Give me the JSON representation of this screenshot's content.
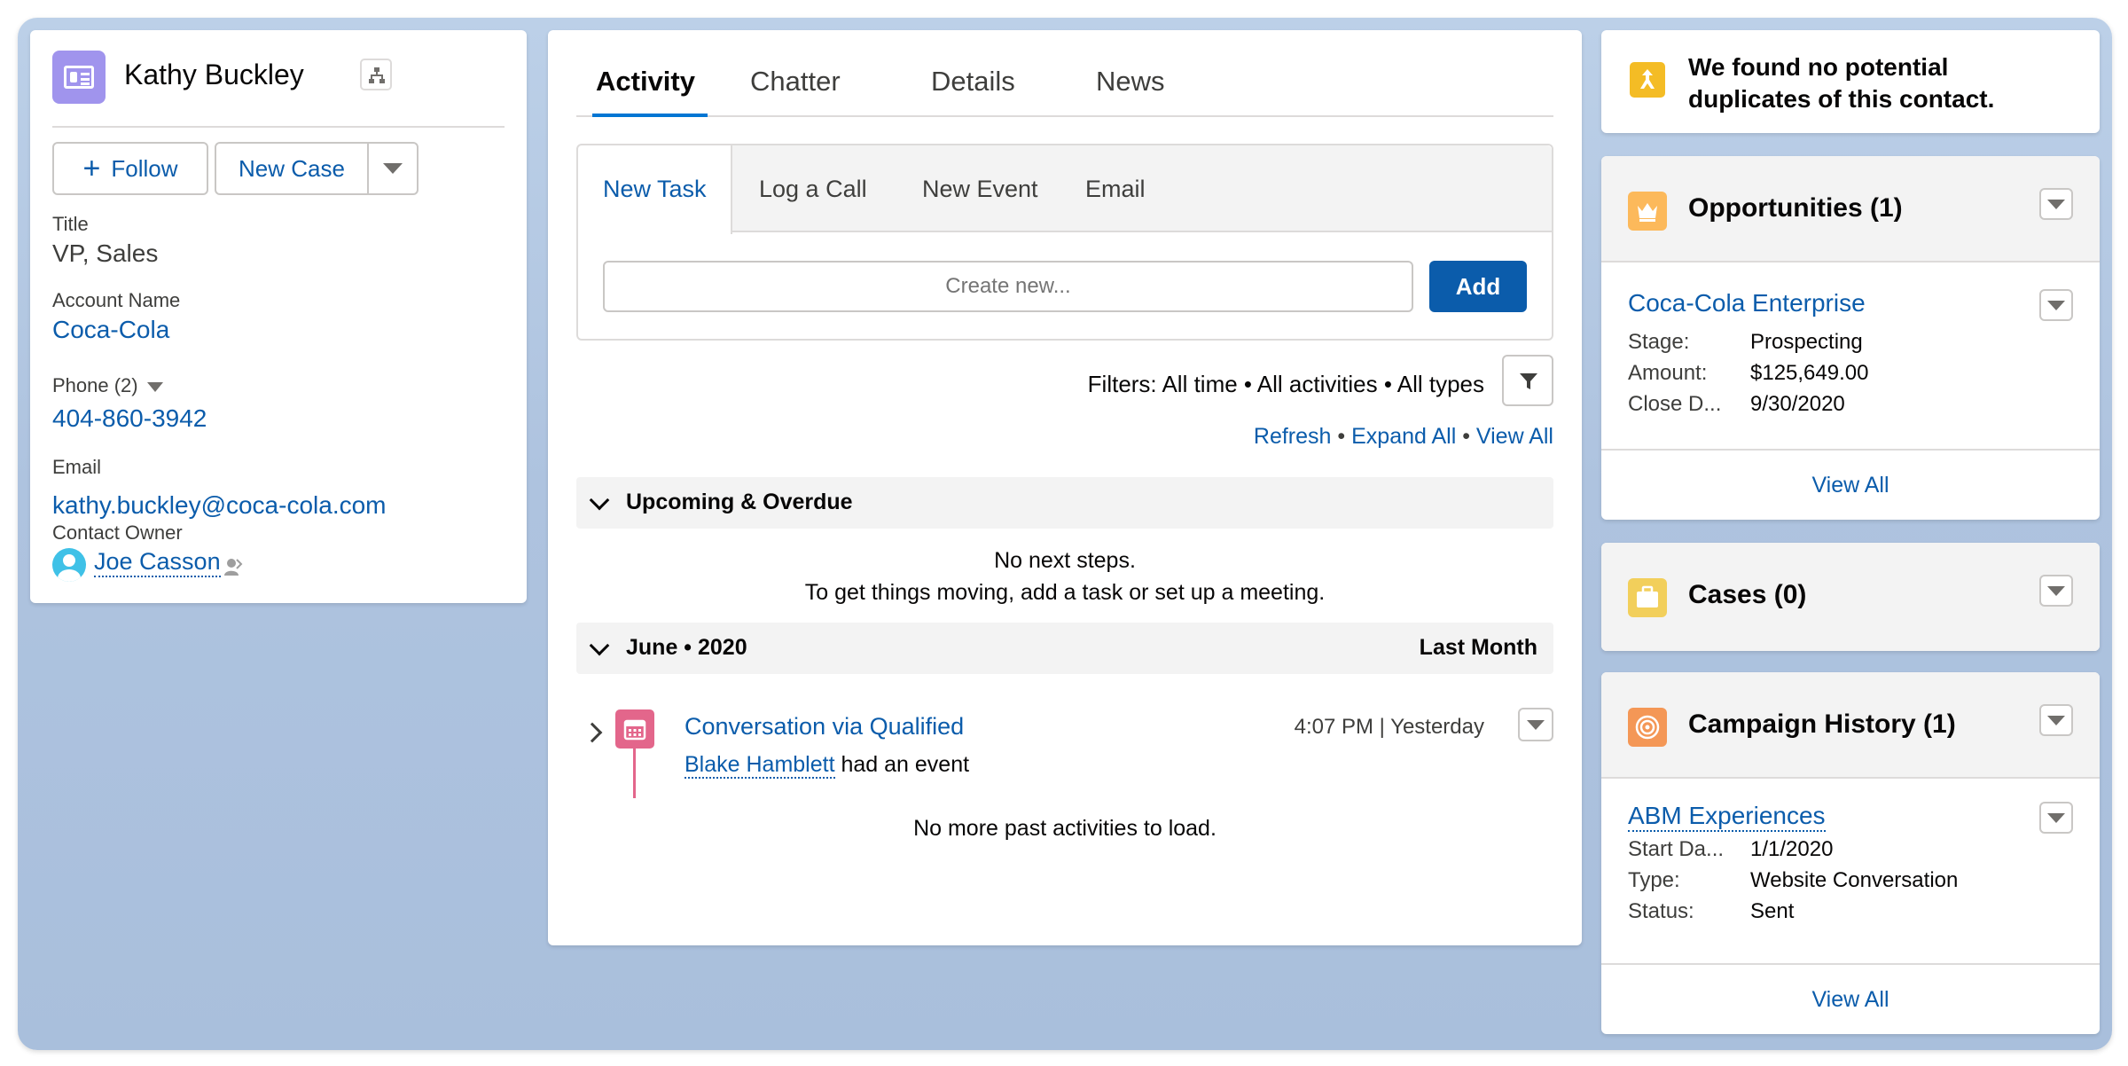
{
  "contact": {
    "name": "Kathy Buckley",
    "follow_label": "Follow",
    "new_case_label": "New Case",
    "fields": {
      "title_label": "Title",
      "title_value": "VP, Sales",
      "account_label": "Account Name",
      "account_value": "Coca-Cola",
      "phone_label": "Phone (2)",
      "phone_value": "404-860-3942",
      "email_label": "Email",
      "email_value": "kathy.buckley@coca-cola.com",
      "owner_label": "Contact Owner",
      "owner_value": "Joe Casson"
    }
  },
  "tabs": [
    "Activity",
    "Chatter",
    "Details",
    "News"
  ],
  "composer": {
    "subtabs": [
      "New Task",
      "Log a Call",
      "New Event",
      "Email"
    ],
    "placeholder": "Create new...",
    "add_label": "Add"
  },
  "activity": {
    "filters": "Filters: All time • All activities • All types",
    "refresh": "Refresh",
    "expand_all": "Expand All",
    "view_all": "View All",
    "upcoming_title": "Upcoming & Overdue",
    "no_steps": "No next steps.",
    "no_steps_hint": "To get things moving, add a task or set up a meeting.",
    "month_title": "June • 2020",
    "month_right": "Last Month",
    "event_title": "Conversation via Qualified",
    "event_time": "4:07 PM | Yesterday",
    "event_person": "Blake Hamblett",
    "event_action": "had an event",
    "no_more": "No more past activities to load."
  },
  "sidebar": {
    "duplicates_line1": "We found no potential",
    "duplicates_line2": "duplicates of this contact.",
    "opportunities": {
      "title": "Opportunities (1)",
      "record": "Coca-Cola Enterprise",
      "rows": [
        {
          "label": "Stage:",
          "value": "Prospecting"
        },
        {
          "label": "Amount:",
          "value": "$125,649.00"
        },
        {
          "label": "Close D...",
          "value": "9/30/2020"
        }
      ],
      "view_all": "View All"
    },
    "cases": {
      "title": "Cases (0)"
    },
    "campaigns": {
      "title": "Campaign History (1)",
      "record": "ABM Experiences",
      "rows": [
        {
          "label": "Start Da...",
          "value": "1/1/2020"
        },
        {
          "label": "Type:",
          "value": "Website Conversation"
        },
        {
          "label": "Status:",
          "value": "Sent"
        }
      ],
      "view_all": "View All"
    }
  },
  "colors": {
    "brand": "#0b5cab",
    "contact_icon": "#a094ed",
    "opportunity_icon": "#fcb95b",
    "case_icon": "#f2cf5b",
    "campaign_icon": "#f49756",
    "event_icon": "#e3668b"
  }
}
